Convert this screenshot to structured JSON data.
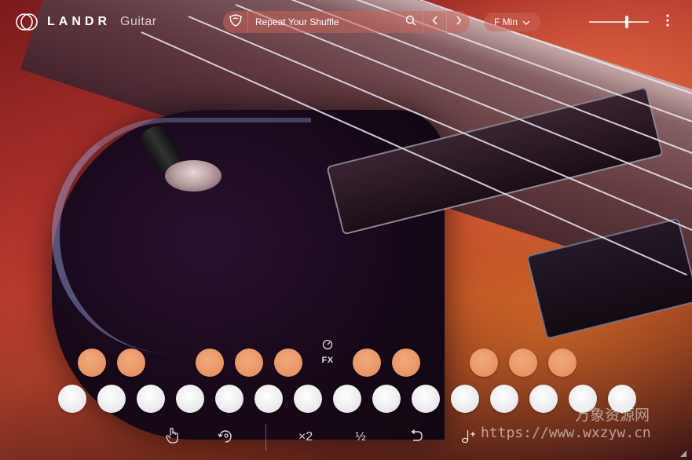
{
  "app": {
    "brand": "LANDR",
    "product": "Guitar"
  },
  "toolbar": {
    "preset_name": "Repeat Your Shuffle",
    "key": "F Min",
    "volume_level": 0.64
  },
  "fx": {
    "label": "FX"
  },
  "bottom_tools": {
    "double_label": "×2",
    "half_label": "½"
  },
  "icons": {
    "logo": "landr-logo-icon",
    "favorite": "heart-shield-icon",
    "search": "search-icon",
    "prev": "chevron-left-icon",
    "next": "chevron-right-icon",
    "key_dropdown": "chevron-down-icon",
    "menu": "kebab-menu-icon",
    "fx": "dial-icon",
    "touch": "hand-pointer-icon",
    "latch": "refresh-hold-icon",
    "undo": "undo-icon",
    "add_note": "note-plus-icon"
  },
  "colors": {
    "chord_pad": "#e99868",
    "note_pad": "#e8e6ea",
    "bar_bg": "#c8645a"
  },
  "watermark": {
    "cn_text": "万象资源网",
    "url_text": "https://www.wxzyw.cn"
  }
}
